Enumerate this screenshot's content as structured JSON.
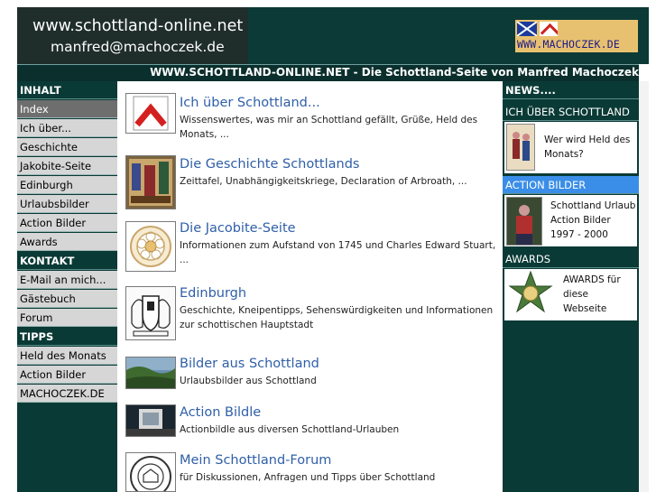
{
  "header": {
    "site_title": "www.schottland-online.net",
    "email": "manfred@machoczek.de",
    "logo_text": "WWW.MACHOCZEK.DE",
    "subtitle": "WWW.SCHOTTLAND-ONLINE.NET - Die Schottland-Seite von Manfred Machoczek"
  },
  "nav": {
    "sections": [
      {
        "heading": "INHALT",
        "items": [
          "Index",
          "Ich über...",
          "Geschichte",
          "Jakobite-Seite",
          "Edinburgh",
          "Urlaubsbilder",
          "Action Bilder",
          "Awards"
        ]
      },
      {
        "heading": "KONTAKT",
        "items": [
          "E-Mail an mich...",
          "Gästebuch",
          "Forum"
        ]
      },
      {
        "heading": "TIPPS",
        "items": [
          "Held des Monats",
          "Action Bilder",
          "MACHOCZEK.DE"
        ]
      }
    ],
    "active_item": "Index"
  },
  "entries": [
    {
      "title": "Ich über Schottland...",
      "desc": "Wissenswertes, was mir an Schottland gefällt, Grüße, Held des Monats, ...",
      "icon": "chevron-logo-icon"
    },
    {
      "title": "Die Geschichte Schottlands",
      "desc": "Zeittafel, Unabhängigkeitskriege, Declaration of Arbroath, ...",
      "icon": "medieval-painting-icon"
    },
    {
      "title": "Die Jacobite-Seite",
      "desc": "Informationen zum Aufstand von 1745 und Charles Edward Stuart, ...",
      "icon": "white-rose-icon"
    },
    {
      "title": "Edinburgh",
      "desc": "Geschichte, Kneipentipps, Sehenswürdigkeiten und Informationen zur schottischen Hauptstadt",
      "icon": "coat-of-arms-icon"
    },
    {
      "title": "Bilder aus Schottland",
      "desc": "Urlaubsbilder aus Schottland",
      "icon": "landscape-photo-icon"
    },
    {
      "title": "Action Bildle",
      "desc": "Actionbildle aus diversen Schottland-Urlauben",
      "icon": "action-photo-icon"
    },
    {
      "title": "Mein Schottland-Forum",
      "desc": "für Diskussionen, Anfragen und Tipps über Schottland",
      "icon": "forum-seal-icon"
    }
  ],
  "right": {
    "news_heading": "NEWS....",
    "blocks": [
      {
        "heading": "ICH ÜBER SCHOTTLAND",
        "text": [
          "Wer wird Held des",
          "Monats?"
        ],
        "icon": "hero-portrait-icon",
        "heading_color": "#0a3a36"
      },
      {
        "heading": "ACTION BILDER",
        "text": [
          "Schottland Urlaub",
          "Action Bilder",
          "1997 - 2000"
        ],
        "icon": "action-photo-icon",
        "heading_color": "#3a8ee8"
      },
      {
        "heading": "AWARDS",
        "text": [
          "AWARDS für",
          "diese",
          "Webseite"
        ],
        "icon": "award-badge-icon",
        "heading_color": "#0a3a36"
      }
    ]
  },
  "colors": {
    "header_bg": "#0c3a36",
    "nav_bg": "#0a3a36",
    "link": "#2f5fa8",
    "accent_blue": "#3a8ee8",
    "logo_bg": "#e8c170"
  }
}
